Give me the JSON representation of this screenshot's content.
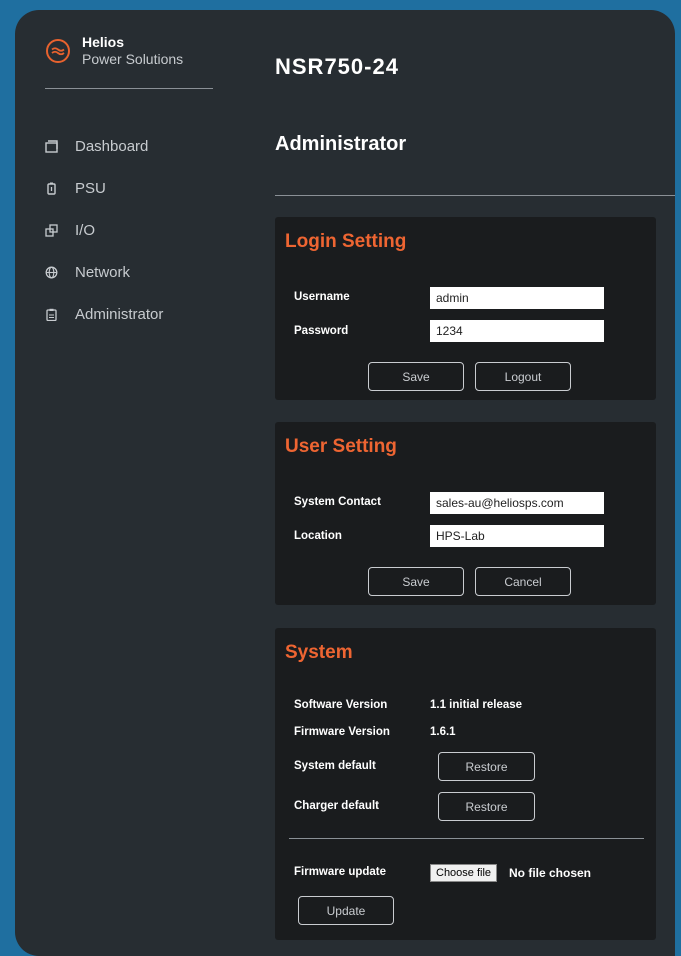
{
  "brand": {
    "name": "Helios",
    "tagline": "Power Solutions"
  },
  "sidebar": {
    "items": [
      {
        "label": "Dashboard",
        "icon": "dashboard-icon"
      },
      {
        "label": "PSU",
        "icon": "battery-icon"
      },
      {
        "label": "I/O",
        "icon": "io-icon"
      },
      {
        "label": "Network",
        "icon": "globe-icon"
      },
      {
        "label": "Administrator",
        "icon": "clipboard-icon"
      }
    ]
  },
  "header": {
    "product": "NSR750-24",
    "page_title": "Administrator"
  },
  "login": {
    "title": "Login Setting",
    "username_label": "Username",
    "username_value": "admin",
    "password_label": "Password",
    "password_value": "1234",
    "save_label": "Save",
    "logout_label": "Logout"
  },
  "user": {
    "title": "User Setting",
    "contact_label": "System Contact",
    "contact_value": "sales-au@heliosps.com",
    "location_label": "Location",
    "location_value": "HPS-Lab",
    "save_label": "Save",
    "cancel_label": "Cancel"
  },
  "system": {
    "title": "System",
    "software_label": "Software Version",
    "software_value": "1.1 initial release",
    "firmware_label": "Firmware Version",
    "firmware_value": "1.6.1",
    "system_default_label": "System default",
    "system_restore_label": "Restore",
    "charger_default_label": "Charger default",
    "charger_restore_label": "Restore",
    "update_label": "Firmware update",
    "choose_file_label": "Choose file",
    "file_status": "No file chosen",
    "update_button_label": "Update"
  },
  "colors": {
    "accent": "#ee6532",
    "background": "#272d32",
    "panel": "#1a1c1e"
  }
}
